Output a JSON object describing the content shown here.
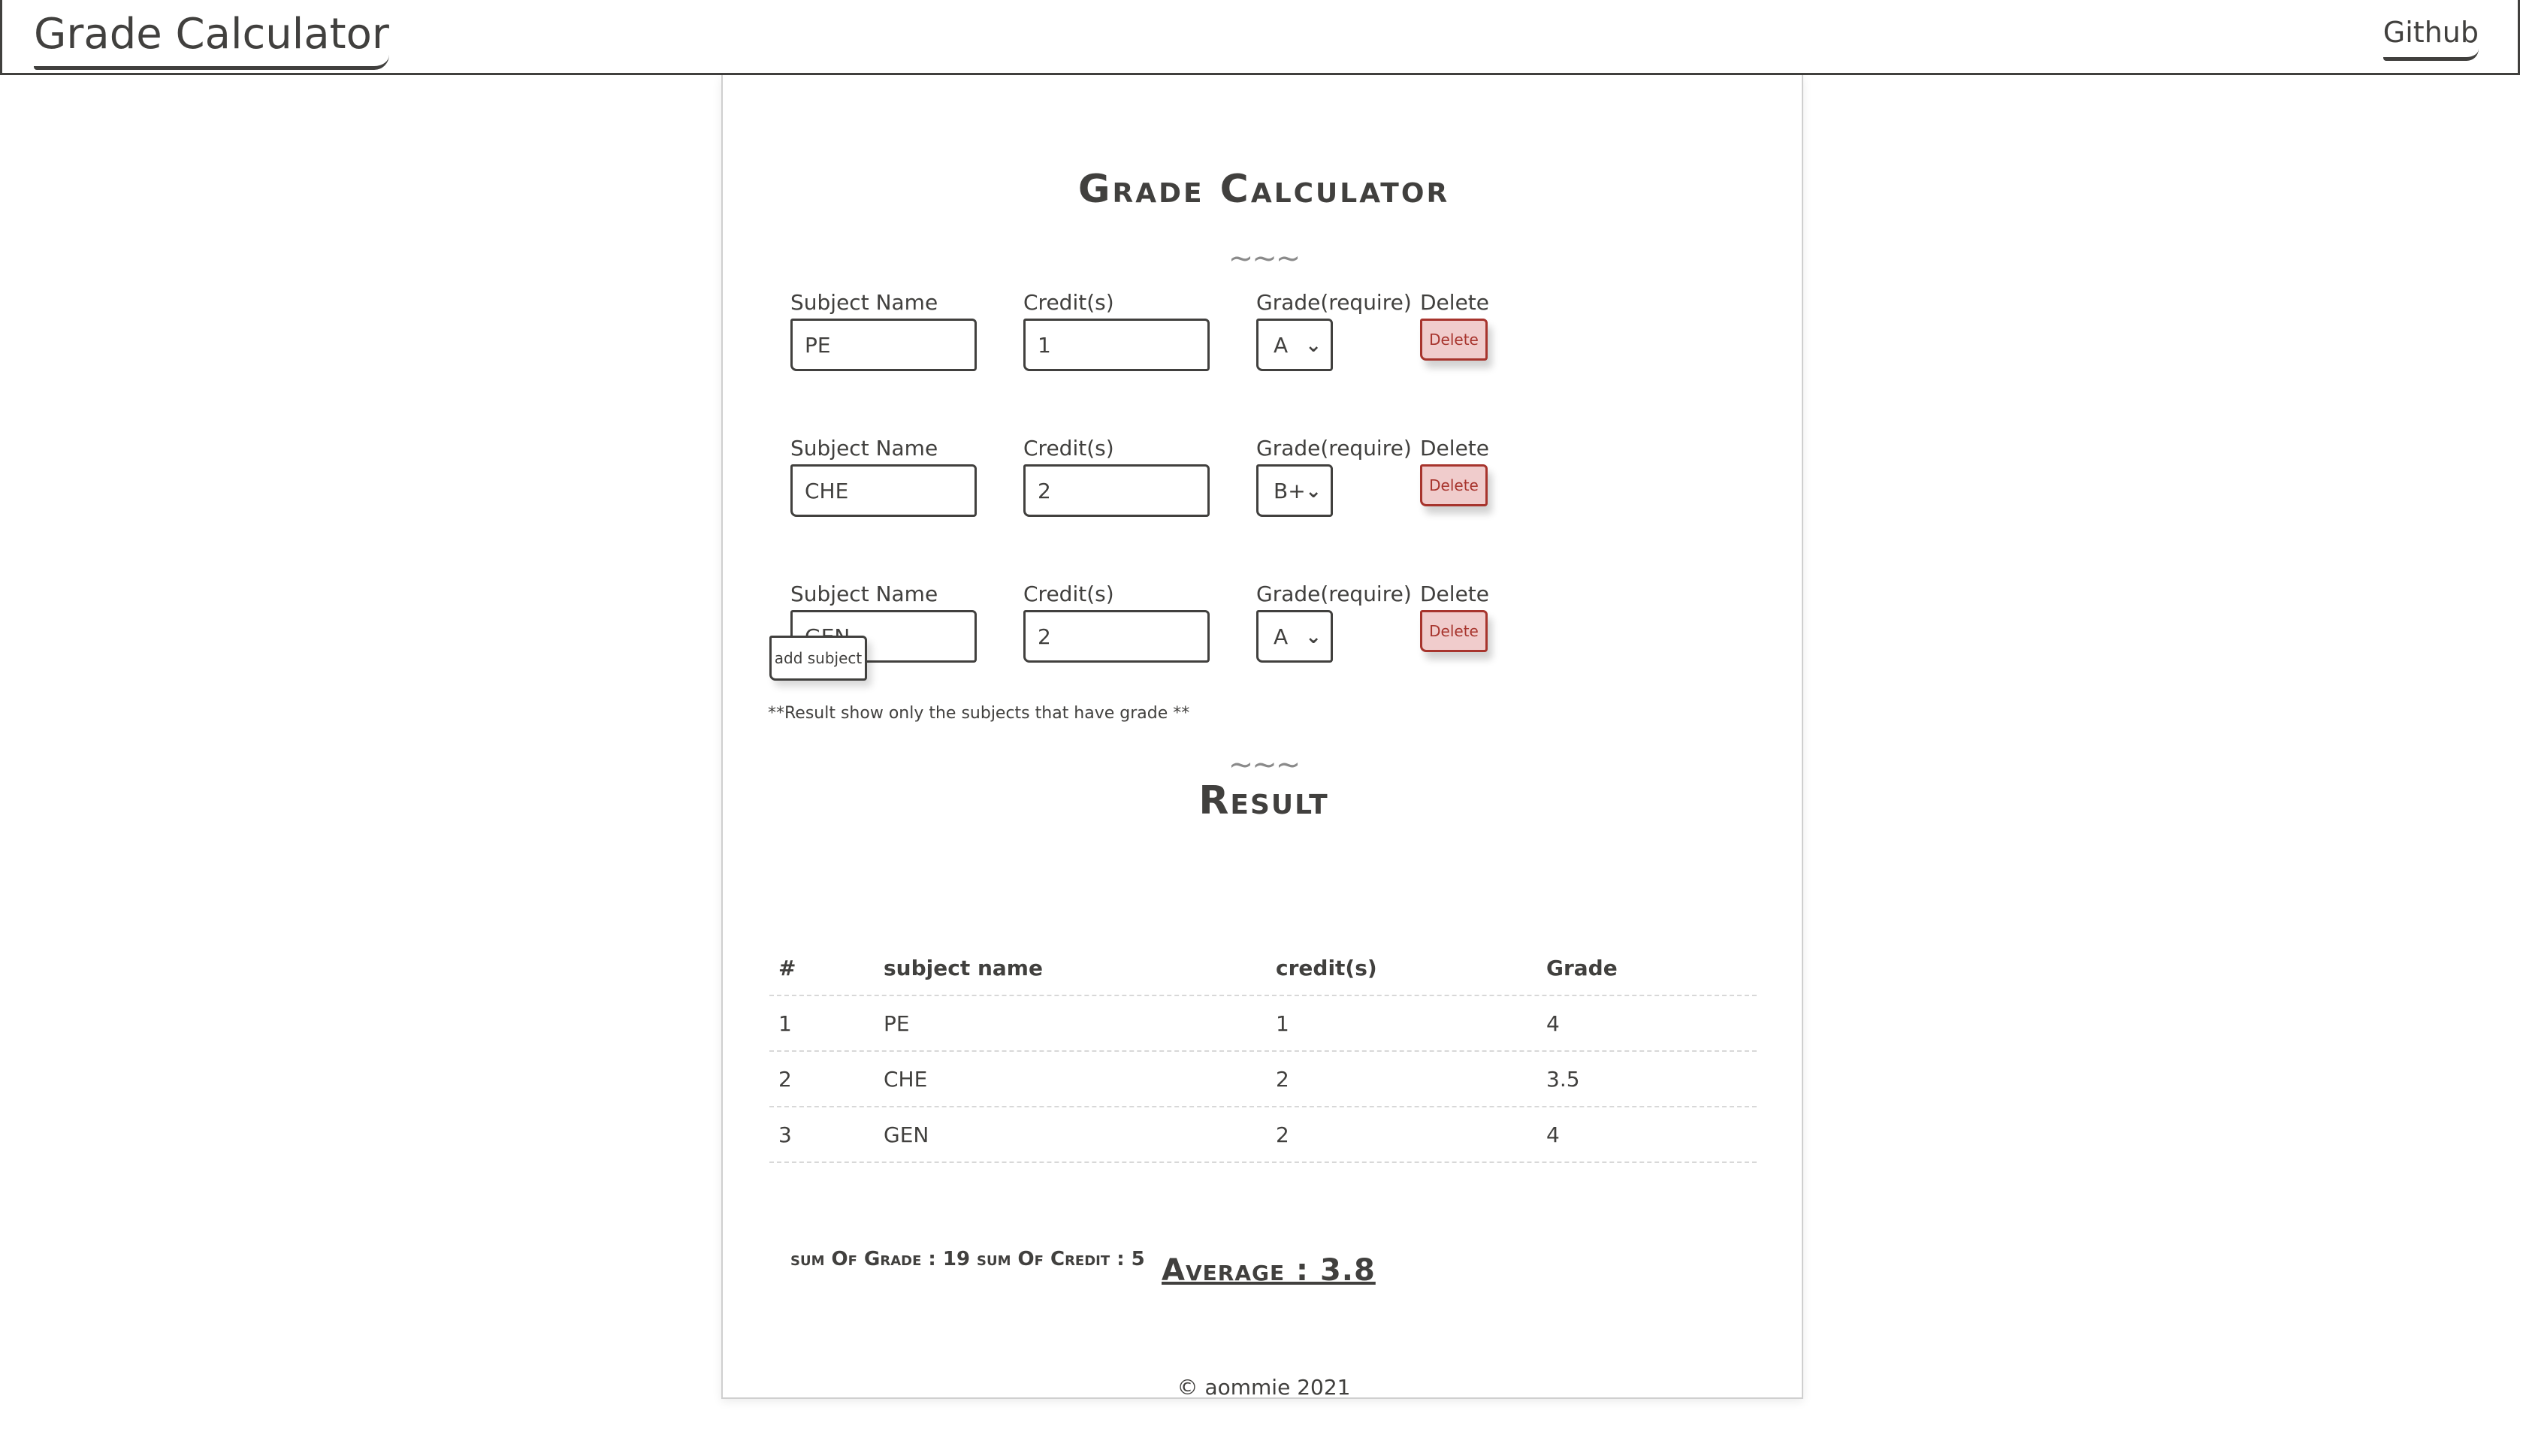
{
  "navbar": {
    "brand": "Grade Calculator",
    "github_link": "Github"
  },
  "main": {
    "title": "Grade Calculator",
    "divider": "~~~",
    "labels": {
      "subject_name": "Subject Name",
      "credits": "Credit(s)",
      "grade": "Grade(require)",
      "delete": "Delete"
    },
    "delete_button": "Delete",
    "subjects": [
      {
        "name": "PE",
        "credits": "1",
        "grade": "A"
      },
      {
        "name": "CHE",
        "credits": "2",
        "grade": "B+"
      },
      {
        "name": "GEN",
        "credits": "2",
        "grade": "A"
      }
    ],
    "add_button": "add subject",
    "note": "**Result show only the subjects that have grade **"
  },
  "result": {
    "title": "Result",
    "columns": [
      "#",
      "subject name",
      "credit(s)",
      "Grade"
    ],
    "rows": [
      [
        "1",
        "PE",
        "1",
        "4"
      ],
      [
        "2",
        "CHE",
        "2",
        "3.5"
      ],
      [
        "3",
        "GEN",
        "2",
        "4"
      ]
    ],
    "sum_grade": "sum Of Grade : 19",
    "sum_credit": "sum Of Credit : 5",
    "average": "Average : 3.8"
  },
  "footer": "© aommie 2021",
  "colors": {
    "text": "#41403e",
    "delete_bg": "#f0cccc",
    "delete_border": "#a7342d"
  }
}
